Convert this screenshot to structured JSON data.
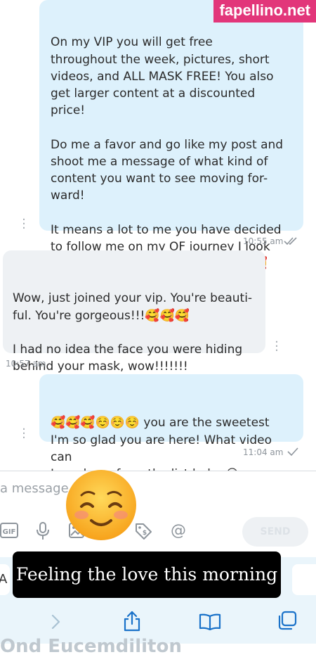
{
  "watermark": "fapellino.net",
  "messages": [
    {
      "direction": "sent",
      "text": "On my VIP you will get free\nthroughout the week, pictures, short\nvideos, and ALL MASK FREE! You also\nget larger content at a discounted price!\n\nDo me a favor and go like my post and\nshoot me a message of what kind of\ncontent you want to see moving for-\nward!\n\nIt means a lot to me you have decided\nto follow me on my OF journey I look\nforward to getting to know you !! 🥰",
      "time": "10:55 am",
      "status": "read"
    },
    {
      "direction": "received",
      "text": "Wow, just joined your vip. You're beauti-\nful. You're gorgeous!!!🥰🥰🥰\n\nI had no idea the face you were hiding\nbehind your mask, wow!!!!!!!",
      "time": "10:57 am"
    },
    {
      "direction": "sent",
      "text": "🥰🥰🥰☺️☺️☺️ you are the sweetest\nI'm so glad you are here! What video can\nI send you from the list babe 😘",
      "time": "11:04 am",
      "status": "sent"
    }
  ],
  "composer": {
    "placeholder": "a message...",
    "send_label": "SEND",
    "gif_label": "GIF",
    "at_symbol": "@"
  },
  "overlay": {
    "emoji": "☺️",
    "caption": "Feeling the love this morning"
  },
  "browser": {
    "left_chip_text": "A",
    "bottom_text": "Ond Eucemdiliton"
  },
  "colors": {
    "sent_bubble": "#ddf1fc",
    "received_bubble": "#eef1f4",
    "watermark_bg": "#e2367a"
  },
  "icons": [
    "gif-icon",
    "microphone-icon",
    "image-icon",
    "price-tag-icon",
    "at-icon",
    "forward-chevron-icon",
    "share-icon",
    "bookmarks-icon",
    "tabs-icon",
    "double-check-icon",
    "single-check-icon",
    "kebab-menu-icon"
  ]
}
